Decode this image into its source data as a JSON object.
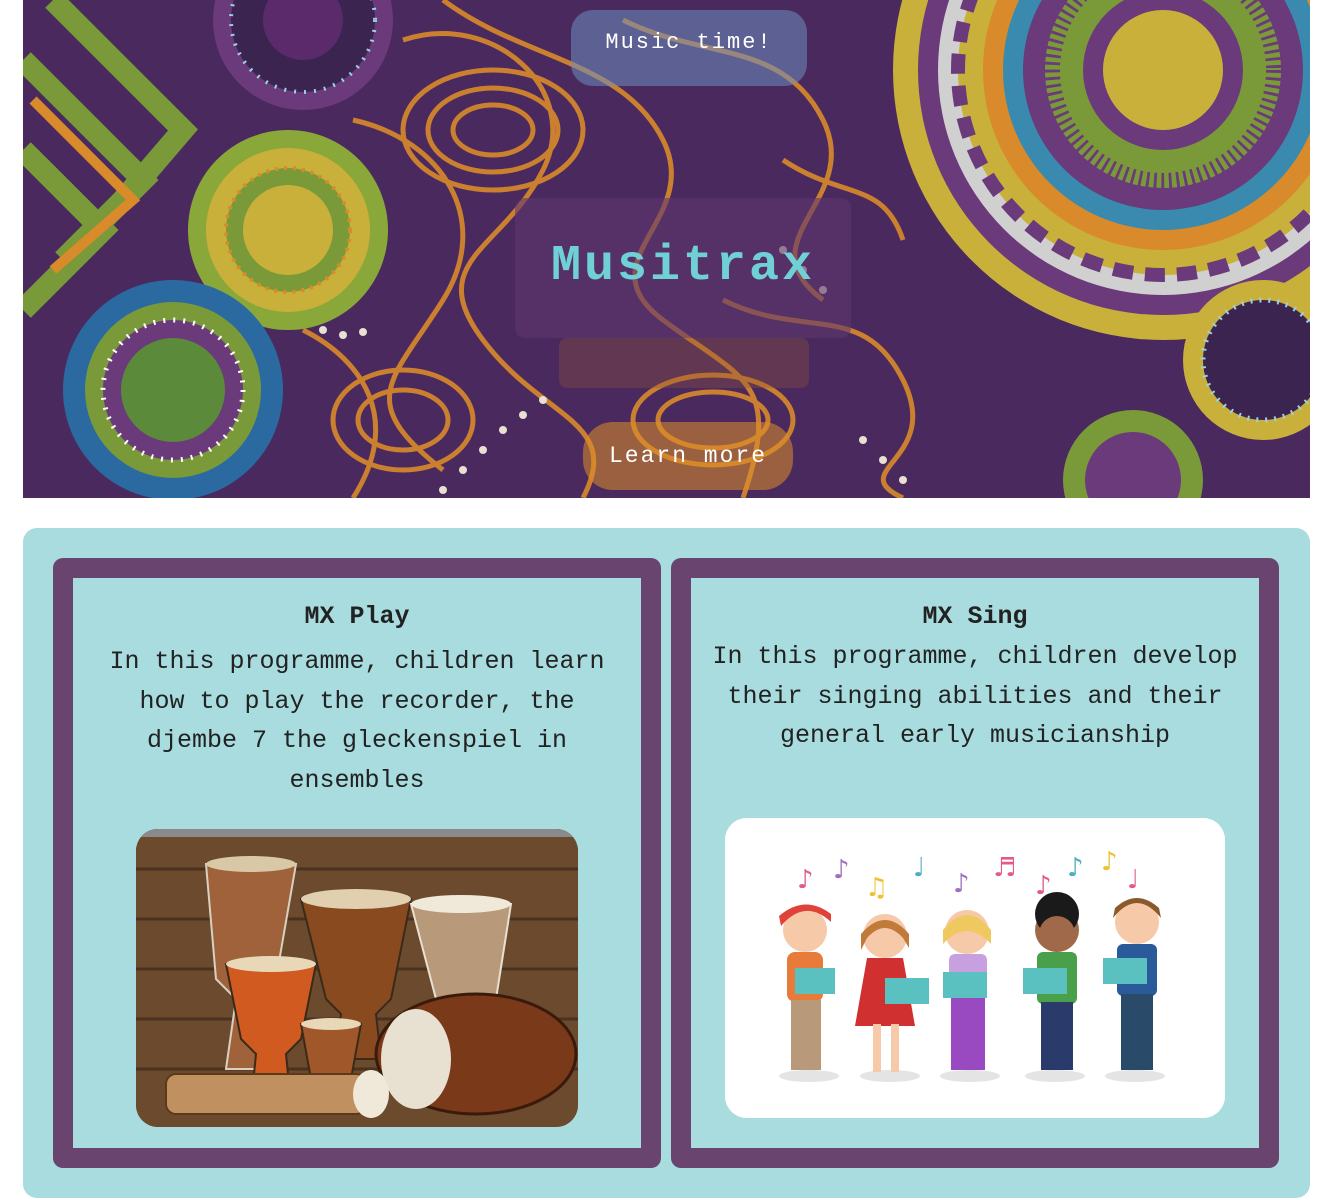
{
  "hero": {
    "tagline": "Music time!",
    "title": "Musitrax",
    "button_label": "Learn more"
  },
  "programs": [
    {
      "title": "MX Play",
      "description": "In this programme, children learn how to play the recorder, the djembe 7 the gleckenspiel in ensembles",
      "image": "djembe-drums-photo"
    },
    {
      "title": "MX Sing",
      "description": "In this programme, children develop their singing abilities and their general early musicianship",
      "image": "children-singing-illustration"
    }
  ],
  "colors": {
    "hero_title": "#6fd0d6",
    "section_bg": "#a8dcdf",
    "card_border": "#68446e",
    "learn_button": "#dc8c28"
  }
}
